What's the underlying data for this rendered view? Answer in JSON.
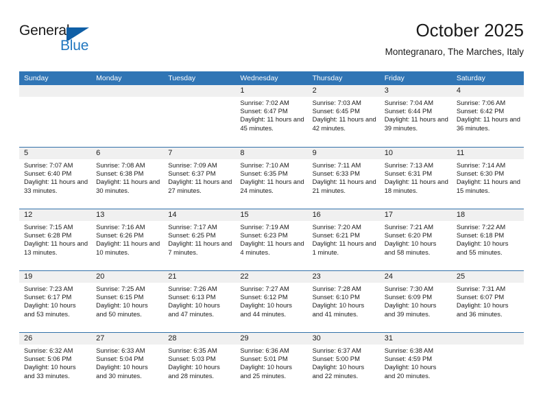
{
  "logo": {
    "word1": "General",
    "word2": "Blue",
    "triangle_color": "#0f5fa6",
    "text_color": "#1a1a1a",
    "blue_color": "#2077c0"
  },
  "header": {
    "title": "October 2025",
    "subtitle": "Montegranaro, The Marches, Italy"
  },
  "colors": {
    "header_blue": "#3075b5",
    "row_divider": "#2f6fa8",
    "day_band": "#f0f0f0",
    "text": "#1a1a1a"
  },
  "weekdays": [
    "Sunday",
    "Monday",
    "Tuesday",
    "Wednesday",
    "Thursday",
    "Friday",
    "Saturday"
  ],
  "weeks": [
    [
      {
        "day": "",
        "empty": true
      },
      {
        "day": "",
        "empty": true
      },
      {
        "day": "",
        "empty": true
      },
      {
        "day": "1",
        "sunrise": "Sunrise: 7:02 AM",
        "sunset": "Sunset: 6:47 PM",
        "daylight": "Daylight: 11 hours and 45 minutes."
      },
      {
        "day": "2",
        "sunrise": "Sunrise: 7:03 AM",
        "sunset": "Sunset: 6:45 PM",
        "daylight": "Daylight: 11 hours and 42 minutes."
      },
      {
        "day": "3",
        "sunrise": "Sunrise: 7:04 AM",
        "sunset": "Sunset: 6:44 PM",
        "daylight": "Daylight: 11 hours and 39 minutes."
      },
      {
        "day": "4",
        "sunrise": "Sunrise: 7:06 AM",
        "sunset": "Sunset: 6:42 PM",
        "daylight": "Daylight: 11 hours and 36 minutes."
      }
    ],
    [
      {
        "day": "5",
        "sunrise": "Sunrise: 7:07 AM",
        "sunset": "Sunset: 6:40 PM",
        "daylight": "Daylight: 11 hours and 33 minutes."
      },
      {
        "day": "6",
        "sunrise": "Sunrise: 7:08 AM",
        "sunset": "Sunset: 6:38 PM",
        "daylight": "Daylight: 11 hours and 30 minutes."
      },
      {
        "day": "7",
        "sunrise": "Sunrise: 7:09 AM",
        "sunset": "Sunset: 6:37 PM",
        "daylight": "Daylight: 11 hours and 27 minutes."
      },
      {
        "day": "8",
        "sunrise": "Sunrise: 7:10 AM",
        "sunset": "Sunset: 6:35 PM",
        "daylight": "Daylight: 11 hours and 24 minutes."
      },
      {
        "day": "9",
        "sunrise": "Sunrise: 7:11 AM",
        "sunset": "Sunset: 6:33 PM",
        "daylight": "Daylight: 11 hours and 21 minutes."
      },
      {
        "day": "10",
        "sunrise": "Sunrise: 7:13 AM",
        "sunset": "Sunset: 6:31 PM",
        "daylight": "Daylight: 11 hours and 18 minutes."
      },
      {
        "day": "11",
        "sunrise": "Sunrise: 7:14 AM",
        "sunset": "Sunset: 6:30 PM",
        "daylight": "Daylight: 11 hours and 15 minutes."
      }
    ],
    [
      {
        "day": "12",
        "sunrise": "Sunrise: 7:15 AM",
        "sunset": "Sunset: 6:28 PM",
        "daylight": "Daylight: 11 hours and 13 minutes."
      },
      {
        "day": "13",
        "sunrise": "Sunrise: 7:16 AM",
        "sunset": "Sunset: 6:26 PM",
        "daylight": "Daylight: 11 hours and 10 minutes."
      },
      {
        "day": "14",
        "sunrise": "Sunrise: 7:17 AM",
        "sunset": "Sunset: 6:25 PM",
        "daylight": "Daylight: 11 hours and 7 minutes."
      },
      {
        "day": "15",
        "sunrise": "Sunrise: 7:19 AM",
        "sunset": "Sunset: 6:23 PM",
        "daylight": "Daylight: 11 hours and 4 minutes."
      },
      {
        "day": "16",
        "sunrise": "Sunrise: 7:20 AM",
        "sunset": "Sunset: 6:21 PM",
        "daylight": "Daylight: 11 hours and 1 minute."
      },
      {
        "day": "17",
        "sunrise": "Sunrise: 7:21 AM",
        "sunset": "Sunset: 6:20 PM",
        "daylight": "Daylight: 10 hours and 58 minutes."
      },
      {
        "day": "18",
        "sunrise": "Sunrise: 7:22 AM",
        "sunset": "Sunset: 6:18 PM",
        "daylight": "Daylight: 10 hours and 55 minutes."
      }
    ],
    [
      {
        "day": "19",
        "sunrise": "Sunrise: 7:23 AM",
        "sunset": "Sunset: 6:17 PM",
        "daylight": "Daylight: 10 hours and 53 minutes."
      },
      {
        "day": "20",
        "sunrise": "Sunrise: 7:25 AM",
        "sunset": "Sunset: 6:15 PM",
        "daylight": "Daylight: 10 hours and 50 minutes."
      },
      {
        "day": "21",
        "sunrise": "Sunrise: 7:26 AM",
        "sunset": "Sunset: 6:13 PM",
        "daylight": "Daylight: 10 hours and 47 minutes."
      },
      {
        "day": "22",
        "sunrise": "Sunrise: 7:27 AM",
        "sunset": "Sunset: 6:12 PM",
        "daylight": "Daylight: 10 hours and 44 minutes."
      },
      {
        "day": "23",
        "sunrise": "Sunrise: 7:28 AM",
        "sunset": "Sunset: 6:10 PM",
        "daylight": "Daylight: 10 hours and 41 minutes."
      },
      {
        "day": "24",
        "sunrise": "Sunrise: 7:30 AM",
        "sunset": "Sunset: 6:09 PM",
        "daylight": "Daylight: 10 hours and 39 minutes."
      },
      {
        "day": "25",
        "sunrise": "Sunrise: 7:31 AM",
        "sunset": "Sunset: 6:07 PM",
        "daylight": "Daylight: 10 hours and 36 minutes."
      }
    ],
    [
      {
        "day": "26",
        "sunrise": "Sunrise: 6:32 AM",
        "sunset": "Sunset: 5:06 PM",
        "daylight": "Daylight: 10 hours and 33 minutes."
      },
      {
        "day": "27",
        "sunrise": "Sunrise: 6:33 AM",
        "sunset": "Sunset: 5:04 PM",
        "daylight": "Daylight: 10 hours and 30 minutes."
      },
      {
        "day": "28",
        "sunrise": "Sunrise: 6:35 AM",
        "sunset": "Sunset: 5:03 PM",
        "daylight": "Daylight: 10 hours and 28 minutes."
      },
      {
        "day": "29",
        "sunrise": "Sunrise: 6:36 AM",
        "sunset": "Sunset: 5:01 PM",
        "daylight": "Daylight: 10 hours and 25 minutes."
      },
      {
        "day": "30",
        "sunrise": "Sunrise: 6:37 AM",
        "sunset": "Sunset: 5:00 PM",
        "daylight": "Daylight: 10 hours and 22 minutes."
      },
      {
        "day": "31",
        "sunrise": "Sunrise: 6:38 AM",
        "sunset": "Sunset: 4:59 PM",
        "daylight": "Daylight: 10 hours and 20 minutes."
      },
      {
        "day": "",
        "empty": true
      }
    ]
  ]
}
